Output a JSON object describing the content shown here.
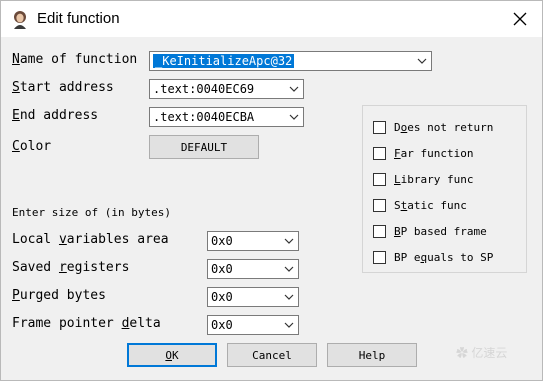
{
  "window": {
    "title": "Edit function"
  },
  "fields": {
    "name": {
      "label_ul": "N",
      "label_rest": "ame of function",
      "value": "_KeInitializeApc@32"
    },
    "start": {
      "label_ul": "S",
      "label_rest": "tart address",
      "value": ".text:0040EC69"
    },
    "end": {
      "label_ul": "E",
      "label_rest": "nd address",
      "value": ".text:0040ECBA"
    },
    "color": {
      "label_ul": "C",
      "label_rest": "olor",
      "button": "DEFAULT"
    }
  },
  "size_section": {
    "heading": "Enter size of (in bytes)",
    "local": {
      "pre": "Local ",
      "ul": "v",
      "post": "ariables area",
      "value": "0x0"
    },
    "saved": {
      "pre": "Saved ",
      "ul": "r",
      "post": "egisters",
      "value": "0x0"
    },
    "purged": {
      "pre": "",
      "ul": "P",
      "post": "urged bytes",
      "value": "0x0"
    },
    "fpd": {
      "pre": "Frame pointer ",
      "ul": "d",
      "post": "elta",
      "value": "0x0"
    }
  },
  "flags": [
    {
      "pre": "D",
      "ul": "o",
      "post": "es not return",
      "checked": false
    },
    {
      "pre": "",
      "ul": "F",
      "post": "ar function",
      "checked": false
    },
    {
      "pre": "",
      "ul": "L",
      "post": "ibrary func",
      "checked": false
    },
    {
      "pre": "S",
      "ul": "t",
      "post": "atic func",
      "checked": false
    },
    {
      "pre": "",
      "ul": "B",
      "post": "P based frame",
      "checked": false
    },
    {
      "pre": "BP e",
      "ul": "q",
      "post": "uals to SP",
      "checked": false
    }
  ],
  "buttons": {
    "ok_ul": "O",
    "ok_rest": "K",
    "cancel": "Cancel",
    "help": "Help"
  },
  "watermark": "✿ 亿速云"
}
